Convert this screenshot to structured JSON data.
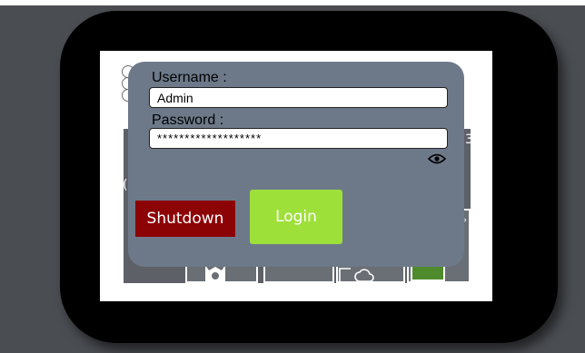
{
  "login": {
    "username_label": "Username :",
    "username_value": "Admin",
    "password_label": "Password :",
    "password_value": "*******************",
    "shutdown_label": "Shutdown",
    "login_label": "Login"
  },
  "icons": {
    "reveal_password": "eye-icon",
    "settings": "gear-icon",
    "cloud": "cloud-icon"
  },
  "colors": {
    "dialog_bg": "#6d7989",
    "shutdown_bg": "#8c0306",
    "login_bg": "#9ee03a",
    "bezel": "#000000",
    "backdrop": "#4a4d52"
  }
}
